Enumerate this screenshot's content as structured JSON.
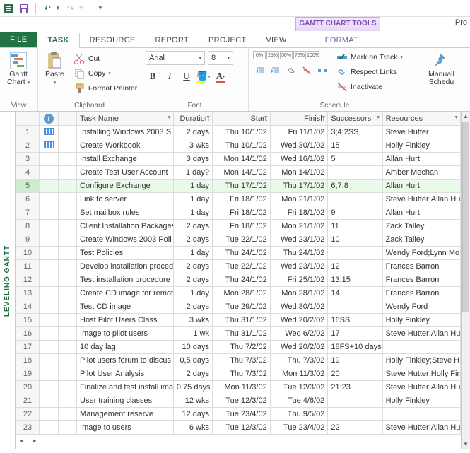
{
  "qat": {
    "tooltab": "GANTT CHART TOOLS",
    "app_right": "Pro"
  },
  "tabs": {
    "file": "FILE",
    "items": [
      "TASK",
      "RESOURCE",
      "REPORT",
      "PROJECT",
      "VIEW"
    ],
    "context": "FORMAT",
    "active_index": 0
  },
  "ribbon": {
    "view": {
      "gantt": "Gantt\nChart",
      "group": "View"
    },
    "clipboard": {
      "paste": "Paste",
      "cut": "Cut",
      "copy": "Copy",
      "painter": "Format Painter",
      "group": "Clipboard"
    },
    "font": {
      "name": "Arial",
      "size": "8",
      "group": "Font"
    },
    "schedule": {
      "mark": "Mark on Track",
      "respect": "Respect Links",
      "inactivate": "Inactivate",
      "pct": [
        "0%",
        "25%",
        "50%",
        "75%",
        "100%"
      ],
      "group": "Schedule"
    },
    "tasks": {
      "manual": "Manuall\nSchedu"
    }
  },
  "columns": {
    "indicators": "i",
    "task_name": "Task Name",
    "duration": "Duration",
    "start": "Start",
    "finish": "Finish",
    "successors": "Successors",
    "resources": "Resources"
  },
  "side_label": "LEVELING GANTT",
  "rows": [
    {
      "n": 1,
      "ind": true,
      "name": "Installing Windows 2003 S",
      "dur": "2 days",
      "start": "Thu 10/1/02",
      "finish": "Fri 11/1/02",
      "succ": "3;4;2SS",
      "res": "Steve Hutter"
    },
    {
      "n": 2,
      "ind": true,
      "name": "Create Workbook",
      "dur": "3 wks",
      "start": "Thu 10/1/02",
      "finish": "Wed 30/1/02",
      "succ": "15",
      "res": "Holly Finkley"
    },
    {
      "n": 3,
      "ind": false,
      "name": "Install Exchange",
      "dur": "3 days",
      "start": "Mon 14/1/02",
      "finish": "Wed 16/1/02",
      "succ": "5",
      "res": "Allan Hurt"
    },
    {
      "n": 4,
      "ind": false,
      "name": "Create Test User Account",
      "dur": "1 day?",
      "start": "Mon 14/1/02",
      "finish": "Mon 14/1/02",
      "succ": "",
      "res": "Amber Mechan"
    },
    {
      "n": 5,
      "ind": false,
      "sel": true,
      "name": "Configure Exchange",
      "dur": "1 day",
      "start": "Thu 17/1/02",
      "finish": "Thu 17/1/02",
      "succ": "6;7;8",
      "res": "Allan Hurt"
    },
    {
      "n": 6,
      "ind": false,
      "name": "Link to server",
      "dur": "1 day",
      "start": "Fri 18/1/02",
      "finish": "Mon 21/1/02",
      "succ": "",
      "res": "Steve Hutter;Allan Hu"
    },
    {
      "n": 7,
      "ind": false,
      "name": "Set mailbox rules",
      "dur": "1 day",
      "start": "Fri 18/1/02",
      "finish": "Fri 18/1/02",
      "succ": "9",
      "res": "Allan Hurt"
    },
    {
      "n": 8,
      "ind": false,
      "name": "Client Installation Packages",
      "dur": "2 days",
      "start": "Fri 18/1/02",
      "finish": "Mon 21/1/02",
      "succ": "11",
      "res": "Zack Talley"
    },
    {
      "n": 9,
      "ind": false,
      "name": "Create Windows 2003 Poli",
      "dur": "2 days",
      "start": "Tue 22/1/02",
      "finish": "Wed 23/1/02",
      "succ": "10",
      "res": "Zack Talley"
    },
    {
      "n": 10,
      "ind": false,
      "name": "Test Policies",
      "dur": "1 day",
      "start": "Thu 24/1/02",
      "finish": "Thu 24/1/02",
      "succ": "",
      "res": "Wendy Ford;Lynn Mo"
    },
    {
      "n": 11,
      "ind": false,
      "name": "Develop installation proced",
      "dur": "2 days",
      "start": "Tue 22/1/02",
      "finish": "Wed 23/1/02",
      "succ": "12",
      "res": "Frances Barron"
    },
    {
      "n": 12,
      "ind": false,
      "name": "Test installation procedure",
      "dur": "2 days",
      "start": "Thu 24/1/02",
      "finish": "Fri 25/1/02",
      "succ": "13;15",
      "res": "Frances Barron"
    },
    {
      "n": 13,
      "ind": false,
      "name": "Create CD image for remot",
      "dur": "1 day",
      "start": "Mon 28/1/02",
      "finish": "Mon 28/1/02",
      "succ": "14",
      "res": "Frances Barron"
    },
    {
      "n": 14,
      "ind": false,
      "name": "Test CD image",
      "dur": "2 days",
      "start": "Tue 29/1/02",
      "finish": "Wed 30/1/02",
      "succ": "",
      "res": "Wendy Ford"
    },
    {
      "n": 15,
      "ind": false,
      "name": "Host Pilot Users Class",
      "dur": "3 wks",
      "start": "Thu 31/1/02",
      "finish": "Wed 20/2/02",
      "succ": "16SS",
      "res": "Holly Finkley"
    },
    {
      "n": 16,
      "ind": false,
      "name": "Image to pilot users",
      "dur": "1 wk",
      "start": "Thu 31/1/02",
      "finish": "Wed 6/2/02",
      "succ": "17",
      "res": "Steve Hutter;Allan Hu"
    },
    {
      "n": 17,
      "ind": false,
      "name": "10 day lag",
      "dur": "10 days",
      "start": "Thu 7/2/02",
      "finish": "Wed 20/2/02",
      "succ": "18FS+10 days",
      "res": ""
    },
    {
      "n": 18,
      "ind": false,
      "name": "Pilot users forum to discus",
      "dur": "0,5 days",
      "start": "Thu 7/3/02",
      "finish": "Thu 7/3/02",
      "succ": "19",
      "res": "Holly Finkley;Steve H"
    },
    {
      "n": 19,
      "ind": false,
      "name": "Pilot User Analysis",
      "dur": "2 days",
      "start": "Thu 7/3/02",
      "finish": "Mon 11/3/02",
      "succ": "20",
      "res": "Steve Hutter;Holly Fin"
    },
    {
      "n": 20,
      "ind": false,
      "name": "Finalize and test install ima",
      "dur": "0,75 days",
      "start": "Mon 11/3/02",
      "finish": "Tue 12/3/02",
      "succ": "21;23",
      "res": "Steve Hutter;Allan Hu"
    },
    {
      "n": 21,
      "ind": false,
      "name": "User training classes",
      "dur": "12 wks",
      "start": "Tue 12/3/02",
      "finish": "Tue 4/6/02",
      "succ": "",
      "res": "Holly Finkley"
    },
    {
      "n": 22,
      "ind": false,
      "name": "Management reserve",
      "dur": "12 days",
      "start": "Tue 23/4/02",
      "finish": "Thu 9/5/02",
      "succ": "",
      "res": ""
    },
    {
      "n": 23,
      "ind": false,
      "name": "Image to users",
      "dur": "6 wks",
      "start": "Tue 12/3/02",
      "finish": "Tue 23/4/02",
      "succ": "22",
      "res": "Steve Hutter;Allan Hu"
    }
  ]
}
